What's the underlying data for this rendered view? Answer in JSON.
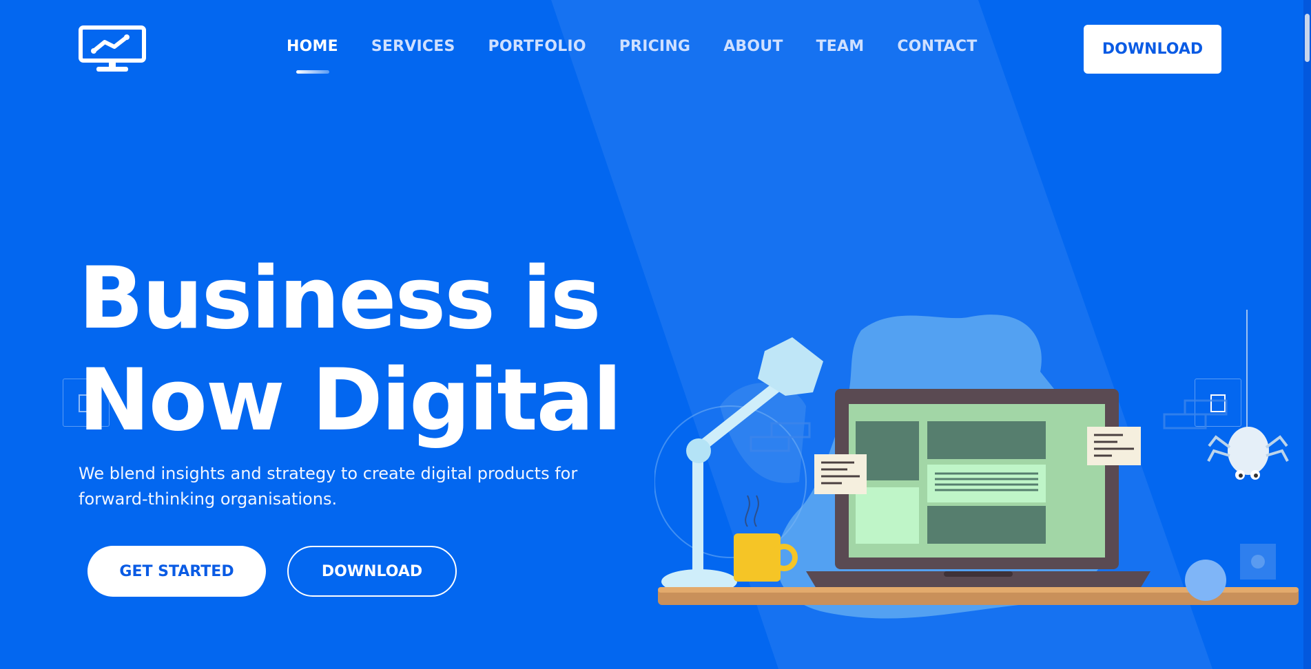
{
  "header": {
    "logo_icon": "monitor-chart-icon",
    "nav": [
      {
        "label": "HOME",
        "active": true
      },
      {
        "label": "SERVICES",
        "active": false
      },
      {
        "label": "PORTFOLIO",
        "active": false
      },
      {
        "label": "PRICING",
        "active": false
      },
      {
        "label": "ABOUT",
        "active": false
      },
      {
        "label": "TEAM",
        "active": false
      },
      {
        "label": "CONTACT",
        "active": false
      }
    ],
    "download_label": "DOWNLOAD"
  },
  "hero": {
    "title_line1": "Business is",
    "title_line2": "Now Digital",
    "subtitle": "We blend insights and strategy to create digital products for forward-thinking organisations.",
    "primary_button": "GET STARTED",
    "secondary_button": "DOWNLOAD"
  },
  "slider": {
    "prev_icon": "square-prev-icon",
    "next_icon": "square-next-icon"
  },
  "colors": {
    "background": "#0367f0",
    "accent_text": "#0a5be4",
    "white": "#ffffff"
  }
}
